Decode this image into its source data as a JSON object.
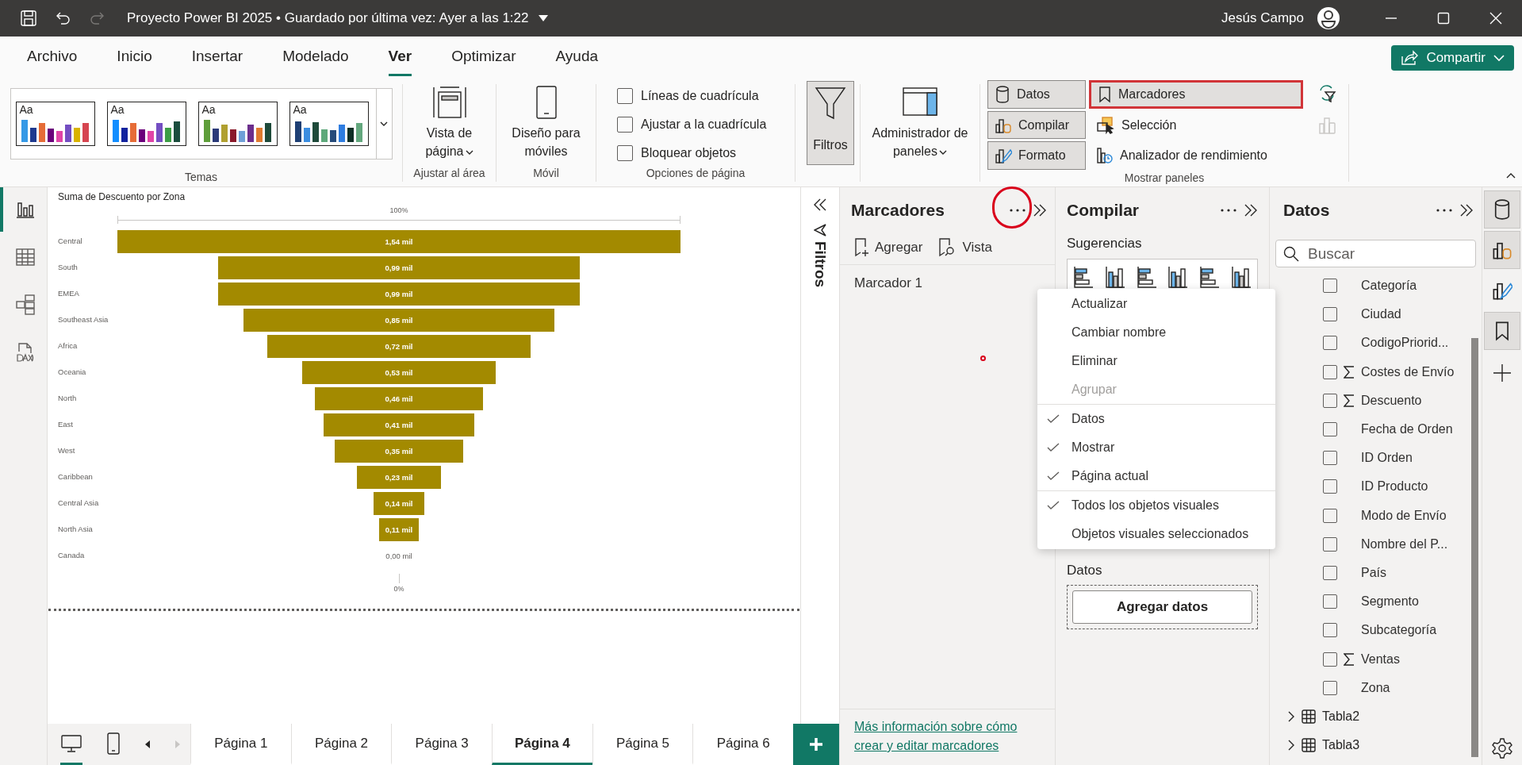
{
  "title_bar": {
    "title": "Proyecto Power BI 2025 • Guardado por última vez: Ayer a las 1:22",
    "user": "Jesús Campo"
  },
  "ribbon": {
    "tabs": [
      {
        "label": "Archivo",
        "selected": false
      },
      {
        "label": "Inicio",
        "selected": false
      },
      {
        "label": "Insertar",
        "selected": false
      },
      {
        "label": "Modelado",
        "selected": false
      },
      {
        "label": "Ver",
        "selected": true
      },
      {
        "label": "Optimizar",
        "selected": false
      },
      {
        "label": "Ayuda",
        "selected": false
      }
    ],
    "share_button": "Compartir",
    "themes": {
      "thumbnails": [
        "Aa",
        "Aa",
        "Aa",
        "Aa"
      ],
      "label": "Temas"
    },
    "page_view": {
      "button": "Vista de página",
      "label": "Ajustar al área"
    },
    "mobile": {
      "button": "Diseño para móviles",
      "label": "Móvil"
    },
    "page_options": {
      "label": "Opciones de página",
      "checkboxes": [
        {
          "label": "Líneas de cuadrícula",
          "checked": false
        },
        {
          "label": "Ajustar a la cuadrícula",
          "checked": false
        },
        {
          "label": "Bloquear objetos",
          "checked": false
        }
      ]
    },
    "filters_button": {
      "label": "Filtros",
      "on": true
    },
    "pane_manager": {
      "label": "Administrador de paneles"
    },
    "show_panes": {
      "label": "Mostrar paneles",
      "buttons": [
        {
          "label": "Datos",
          "on": true,
          "highlighted": false
        },
        {
          "label": "Compilar",
          "on": true,
          "highlighted": false
        },
        {
          "label": "Formato",
          "on": true,
          "highlighted": false
        },
        {
          "label": "Marcadores",
          "on": true,
          "highlighted": true
        },
        {
          "label": "Selección",
          "on": false,
          "highlighted": false
        },
        {
          "label": "Analizador de rendimiento",
          "on": false,
          "highlighted": false
        }
      ]
    }
  },
  "left_nav": [
    {
      "selected": true
    },
    {
      "selected": false
    },
    {
      "selected": false
    },
    {
      "selected": false
    }
  ],
  "canvas": {
    "title": "Suma de Descuento por Zona",
    "funnel_top_label": "100%",
    "funnel_bottom_label": "0%",
    "stages": [
      {
        "label": "Central",
        "value": "1,54 mil"
      },
      {
        "label": "South",
        "value": "0,99 mil"
      },
      {
        "label": "EMEA",
        "value": "0,99 mil"
      },
      {
        "label": "Southeast Asia",
        "value": "0,85 mil"
      },
      {
        "label": "Africa",
        "value": "0,72 mil"
      },
      {
        "label": "Oceania",
        "value": "0,53 mil"
      },
      {
        "label": "North",
        "value": "0,46 mil"
      },
      {
        "label": "East",
        "value": "0,41 mil"
      },
      {
        "label": "West",
        "value": "0,35 mil"
      },
      {
        "label": "Caribbean",
        "value": "0,23 mil"
      },
      {
        "label": "Central Asia",
        "value": "0,14 mil"
      },
      {
        "label": "North Asia",
        "value": "0,11 mil"
      },
      {
        "label": "Canada",
        "value": "0,00 mil"
      }
    ]
  },
  "filters_pane": {
    "label": "Filtros"
  },
  "bookmarks_pane": {
    "title": "Marcadores",
    "actions": [
      "Agregar",
      "Vista"
    ],
    "bookmarks": [
      "Marcador 1"
    ],
    "help_link": "Más información sobre cómo crear y editar marcadores"
  },
  "context_menu": {
    "groups": [
      [
        {
          "label": "Actualizar",
          "checked": false,
          "disabled": false
        },
        {
          "label": "Cambiar nombre",
          "checked": false,
          "disabled": false
        },
        {
          "label": "Eliminar",
          "checked": false,
          "disabled": false
        },
        {
          "label": "Agrupar",
          "checked": false,
          "disabled": true
        }
      ],
      [
        {
          "label": "Datos",
          "checked": true,
          "disabled": false
        },
        {
          "label": "Mostrar",
          "checked": true,
          "disabled": false
        },
        {
          "label": "Página actual",
          "checked": true,
          "disabled": false
        }
      ],
      [
        {
          "label": "Todos los objetos visuales",
          "checked": true,
          "disabled": false
        },
        {
          "label": "Objetos visuales seleccionados",
          "checked": false,
          "disabled": false
        }
      ]
    ]
  },
  "build_pane": {
    "title": "Compilar",
    "suggestions_label": "Sugerencias",
    "data_label": "Datos",
    "add_data_button": "Agregar datos"
  },
  "data_pane": {
    "title": "Datos",
    "search_placeholder": "Buscar",
    "fields": [
      {
        "label": "Categoría",
        "checked": false,
        "summed": false
      },
      {
        "label": "Ciudad",
        "checked": false,
        "summed": false
      },
      {
        "label": "CodigoPriorid...",
        "checked": false,
        "summed": false
      },
      {
        "label": "Costes de Envío",
        "checked": false,
        "summed": true
      },
      {
        "label": "Descuento",
        "checked": false,
        "summed": true
      },
      {
        "label": "Fecha de Orden",
        "checked": false,
        "summed": false
      },
      {
        "label": "ID Orden",
        "checked": false,
        "summed": false
      },
      {
        "label": "ID Producto",
        "checked": false,
        "summed": false
      },
      {
        "label": "Modo de Envío",
        "checked": false,
        "summed": false
      },
      {
        "label": "Nombre del P...",
        "checked": false,
        "summed": false
      },
      {
        "label": "País",
        "checked": false,
        "summed": false
      },
      {
        "label": "Segmento",
        "checked": false,
        "summed": false
      },
      {
        "label": "Subcategoría",
        "checked": false,
        "summed": false
      },
      {
        "label": "Ventas",
        "checked": false,
        "summed": true
      },
      {
        "label": "Zona",
        "checked": false,
        "summed": false
      }
    ],
    "tables": [
      {
        "label": "Tabla2",
        "expanded": false
      },
      {
        "label": "Tabla3",
        "expanded": false
      }
    ]
  },
  "side_strip": [
    {
      "selected": true
    },
    {
      "selected": true
    },
    {
      "selected": false
    },
    {
      "selected": true
    }
  ],
  "page_tabs": {
    "layouts": [
      {
        "selected": true
      },
      {
        "selected": false
      }
    ],
    "tabs": [
      {
        "label": "Página 1",
        "selected": false
      },
      {
        "label": "Página 2",
        "selected": false
      },
      {
        "label": "Página 3",
        "selected": false
      },
      {
        "label": "Página 4",
        "selected": true
      },
      {
        "label": "Página 5",
        "selected": false
      },
      {
        "label": "Página 6",
        "selected": false
      }
    ]
  }
}
